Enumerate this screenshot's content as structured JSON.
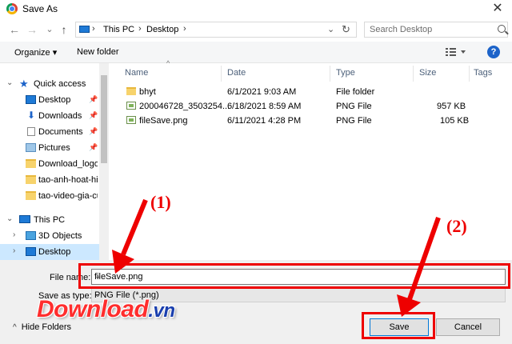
{
  "window": {
    "title": "Save As",
    "close": "✕"
  },
  "nav": {
    "back": "←",
    "forward": "→",
    "recent": "⌄",
    "up": "↑"
  },
  "address": {
    "crumbs": [
      "This PC",
      "Desktop"
    ],
    "sep": "›",
    "drop": "⌄",
    "refresh": "↻"
  },
  "search": {
    "placeholder": "Search Desktop"
  },
  "toolbar": {
    "organize": "Organize ▾",
    "new_folder": "New folder",
    "help": "?"
  },
  "sidebar": {
    "quick_access": "Quick access",
    "items": [
      {
        "label": "Desktop",
        "pinned": true
      },
      {
        "label": "Downloads",
        "pinned": true
      },
      {
        "label": "Documents",
        "pinned": true
      },
      {
        "label": "Pictures",
        "pinned": true
      },
      {
        "label": "Download_logo",
        "pinned": false
      },
      {
        "label": "tao-anh-hoat-hi",
        "pinned": false
      },
      {
        "label": "tao-video-gia-cu",
        "pinned": false
      }
    ],
    "this_pc": "This PC",
    "pc_items": [
      {
        "label": "3D Objects"
      },
      {
        "label": "Desktop"
      }
    ],
    "pin_glyph": "📌"
  },
  "columns": {
    "name": "Name",
    "date": "Date",
    "type": "Type",
    "size": "Size",
    "tags": "Tags",
    "sort": "^"
  },
  "files": [
    {
      "name": "bhyt",
      "date": "6/1/2021 9:03 AM",
      "type": "File folder",
      "size": ""
    },
    {
      "name": "200046728_3503254...",
      "date": "6/18/2021 8:59 AM",
      "type": "PNG File",
      "size": "957 KB"
    },
    {
      "name": "fileSave.png",
      "date": "6/11/2021 4:28 PM",
      "type": "PNG File",
      "size": "105 KB"
    }
  ],
  "form": {
    "file_name_label": "File name:",
    "file_name_value": "fileSave.png",
    "save_as_type_label": "Save as type:",
    "save_as_type_value": "PNG File (*.png)",
    "dropdown": "⌄"
  },
  "footer": {
    "hide_folders": "Hide Folders",
    "hide_arrow": "^",
    "save": "Save",
    "cancel": "Cancel"
  },
  "annotations": {
    "callout1": "(1)",
    "callout2": "(2)",
    "color": "#e00000"
  },
  "watermark": {
    "main": "Download",
    "suffix": ".vn"
  }
}
